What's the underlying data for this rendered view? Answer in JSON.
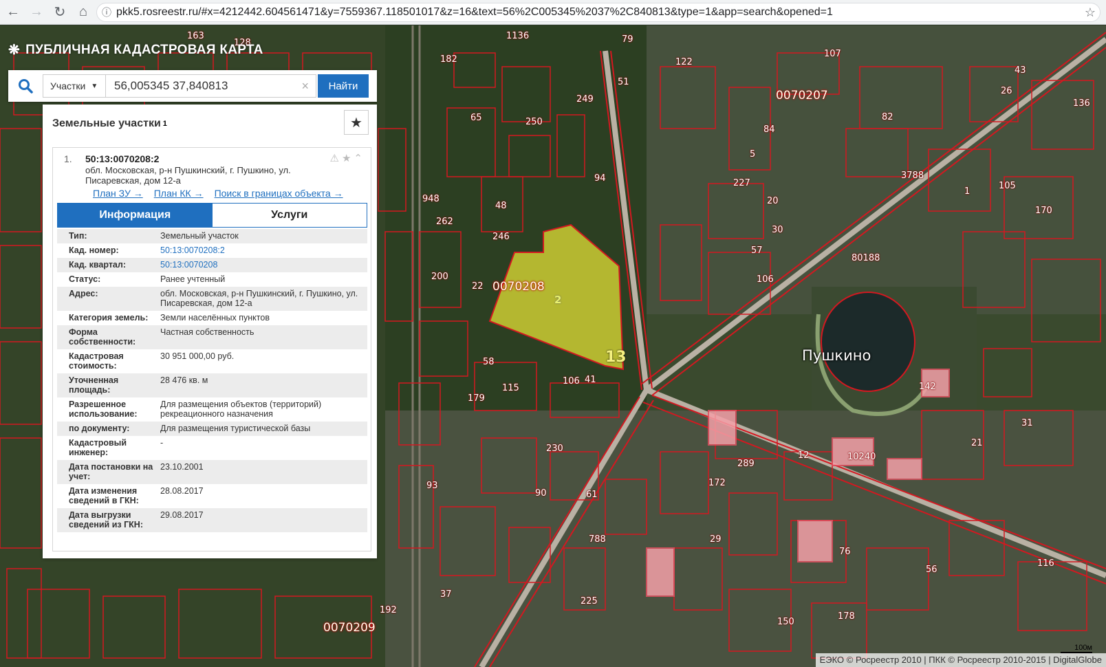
{
  "browser": {
    "url": "pkk5.rosreestr.ru/#x=4212442.604561471&y=7559367.118501017&z=16&text=56%2C005345%2037%2C840813&type=1&app=search&opened=1",
    "back_icon": "arrow-left",
    "forward_icon": "arrow-right",
    "reload_icon": "reload",
    "home_icon": "home",
    "info_icon": "info",
    "bookmark_icon": "star"
  },
  "app": {
    "title": "ПУБЛИЧНАЯ КАДАСТРОВАЯ КАРТА"
  },
  "search": {
    "type_label": "Участки",
    "query": "56,005345 37,840813",
    "clear_glyph": "×",
    "find_label": "Найти"
  },
  "results": {
    "header": "Земельные участки",
    "count": "1",
    "item": {
      "index": "1.",
      "cad_number": "50:13:0070208:2",
      "address": "обл. Московская, р-н Пушкинский, г. Пушкино, ул. Писаревская, дом 12-а",
      "links": [
        "План ЗУ →",
        "План КК →",
        "Поиск в границах объекта →"
      ],
      "tabs": [
        "Информация",
        "Услуги"
      ],
      "rows": [
        {
          "k": "Тип:",
          "v": "Земельный участок"
        },
        {
          "k": "Кад. номер:",
          "v": "50:13:0070208:2",
          "link": true
        },
        {
          "k": "Кад. квартал:",
          "v": "50:13:0070208",
          "link": true
        },
        {
          "k": "Статус:",
          "v": "Ранее учтенный"
        },
        {
          "k": "Адрес:",
          "v": "обл. Московская, р-н Пушкинский, г. Пушкино, ул. Писаревская, дом 12-а"
        },
        {
          "k": "Категория земель:",
          "v": "Земли населённых пунктов"
        },
        {
          "k": "Форма собственности:",
          "v": "Частная собственность"
        },
        {
          "k": "Кадастровая стоимость:",
          "v": "30 951 000,00 руб."
        },
        {
          "k": "Уточненная площадь:",
          "v": "28 476 кв. м"
        },
        {
          "k": "Разрешенное использование:",
          "v": "Для размещения объектов (территорий) рекреационного назначения"
        },
        {
          "k": "по документу:",
          "v": "Для размещения туристической базы"
        },
        {
          "k": "Кадастровый инженер:",
          "v": "-"
        },
        {
          "k": "Дата постановки на учет:",
          "v": "23.10.2001"
        },
        {
          "k": "Дата изменения сведений в ГКН:",
          "v": "28.08.2017"
        },
        {
          "k": "Дата выгрузки сведений из ГКН:",
          "v": "29.08.2017"
        }
      ]
    }
  },
  "map": {
    "blocks": [
      "0070207",
      "0070208",
      "0070209"
    ],
    "city": "Пушкино",
    "parcel_label": "2",
    "quarter_number": "13",
    "road_labels": [
      "80188",
      "10240"
    ],
    "house_numbers": [
      "163",
      "128",
      "79",
      "182",
      "1136",
      "51",
      "122",
      "107",
      "43",
      "26",
      "136",
      "65",
      "250",
      "249",
      "82",
      "84",
      "5",
      "3788",
      "1",
      "105",
      "170",
      "948",
      "262",
      "48",
      "94",
      "227",
      "20",
      "30",
      "246",
      "57",
      "106",
      "22",
      "200",
      "58",
      "179",
      "115",
      "106",
      "41",
      "230",
      "142",
      "61",
      "31",
      "21",
      "12",
      "93",
      "90",
      "172",
      "289",
      "29",
      "76",
      "56",
      "37",
      "192",
      "788",
      "225",
      "178",
      "150",
      "116"
    ],
    "attribution": "ЕЭКО © Росреестр 2010 | ПКК © Росреестр 2010-2015 | DigitalGlobe",
    "scale_label": "100м"
  },
  "colors": {
    "accent": "#1f6fbf",
    "parcel_fill": "#cccc33",
    "boundary": "#d41820"
  }
}
